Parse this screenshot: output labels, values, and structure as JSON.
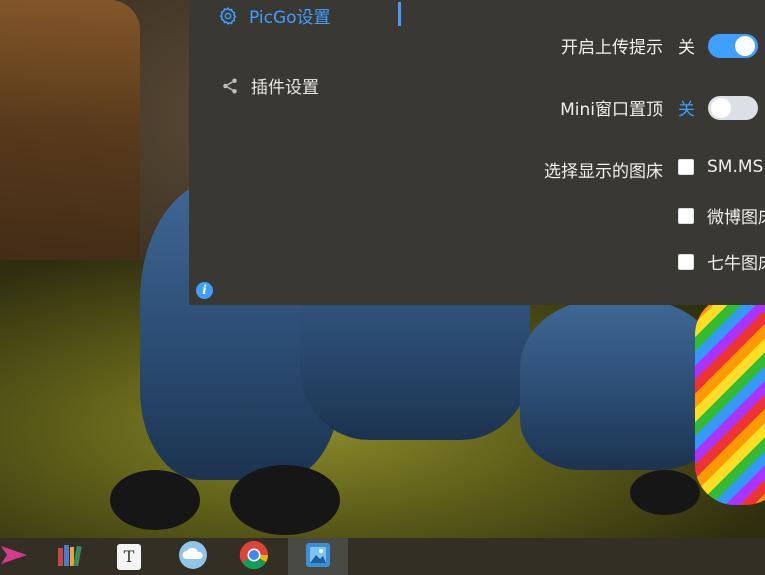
{
  "sidebar": {
    "items": [
      {
        "label": "PicGo设置",
        "icon": "gear-icon",
        "active": true
      },
      {
        "label": "插件设置",
        "icon": "share-icon",
        "active": false
      }
    ]
  },
  "settings": {
    "upload_prompt": {
      "label": "开启上传提示",
      "state_text": "关",
      "on": true
    },
    "mini_top": {
      "label": "Mini窗口置顶",
      "state_text": "关",
      "on": false
    },
    "image_beds": {
      "label": "选择显示的图床",
      "options": [
        {
          "label": "SM.MS",
          "checked": false
        },
        {
          "label": "微博图床",
          "checked": false
        },
        {
          "label": "七牛图床",
          "checked": false
        }
      ]
    }
  },
  "info_icon": "i",
  "colors": {
    "accent": "#409eff",
    "window_bg": "#3a3833",
    "switch_off": "#dcdfe6"
  },
  "taskbar": {
    "items": [
      "send-arrow-icon",
      "books-icon",
      "typora-icon",
      "cloud-icon",
      "chrome-icon",
      "picgo-icon"
    ],
    "typora_glyph": "T"
  }
}
